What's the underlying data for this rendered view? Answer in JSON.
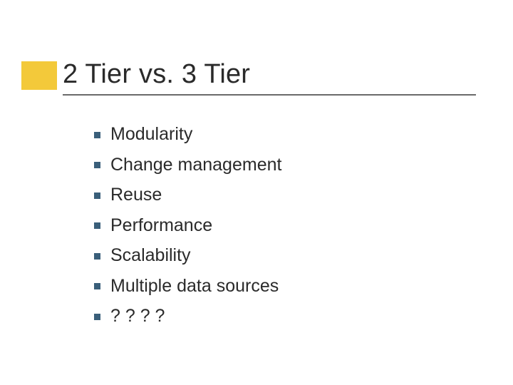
{
  "title": "2 Tier vs. 3 Tier",
  "items": [
    "Modularity",
    "Change management",
    "Reuse",
    "Performance",
    "Scalability",
    "Multiple data sources",
    "? ? ? ?"
  ]
}
